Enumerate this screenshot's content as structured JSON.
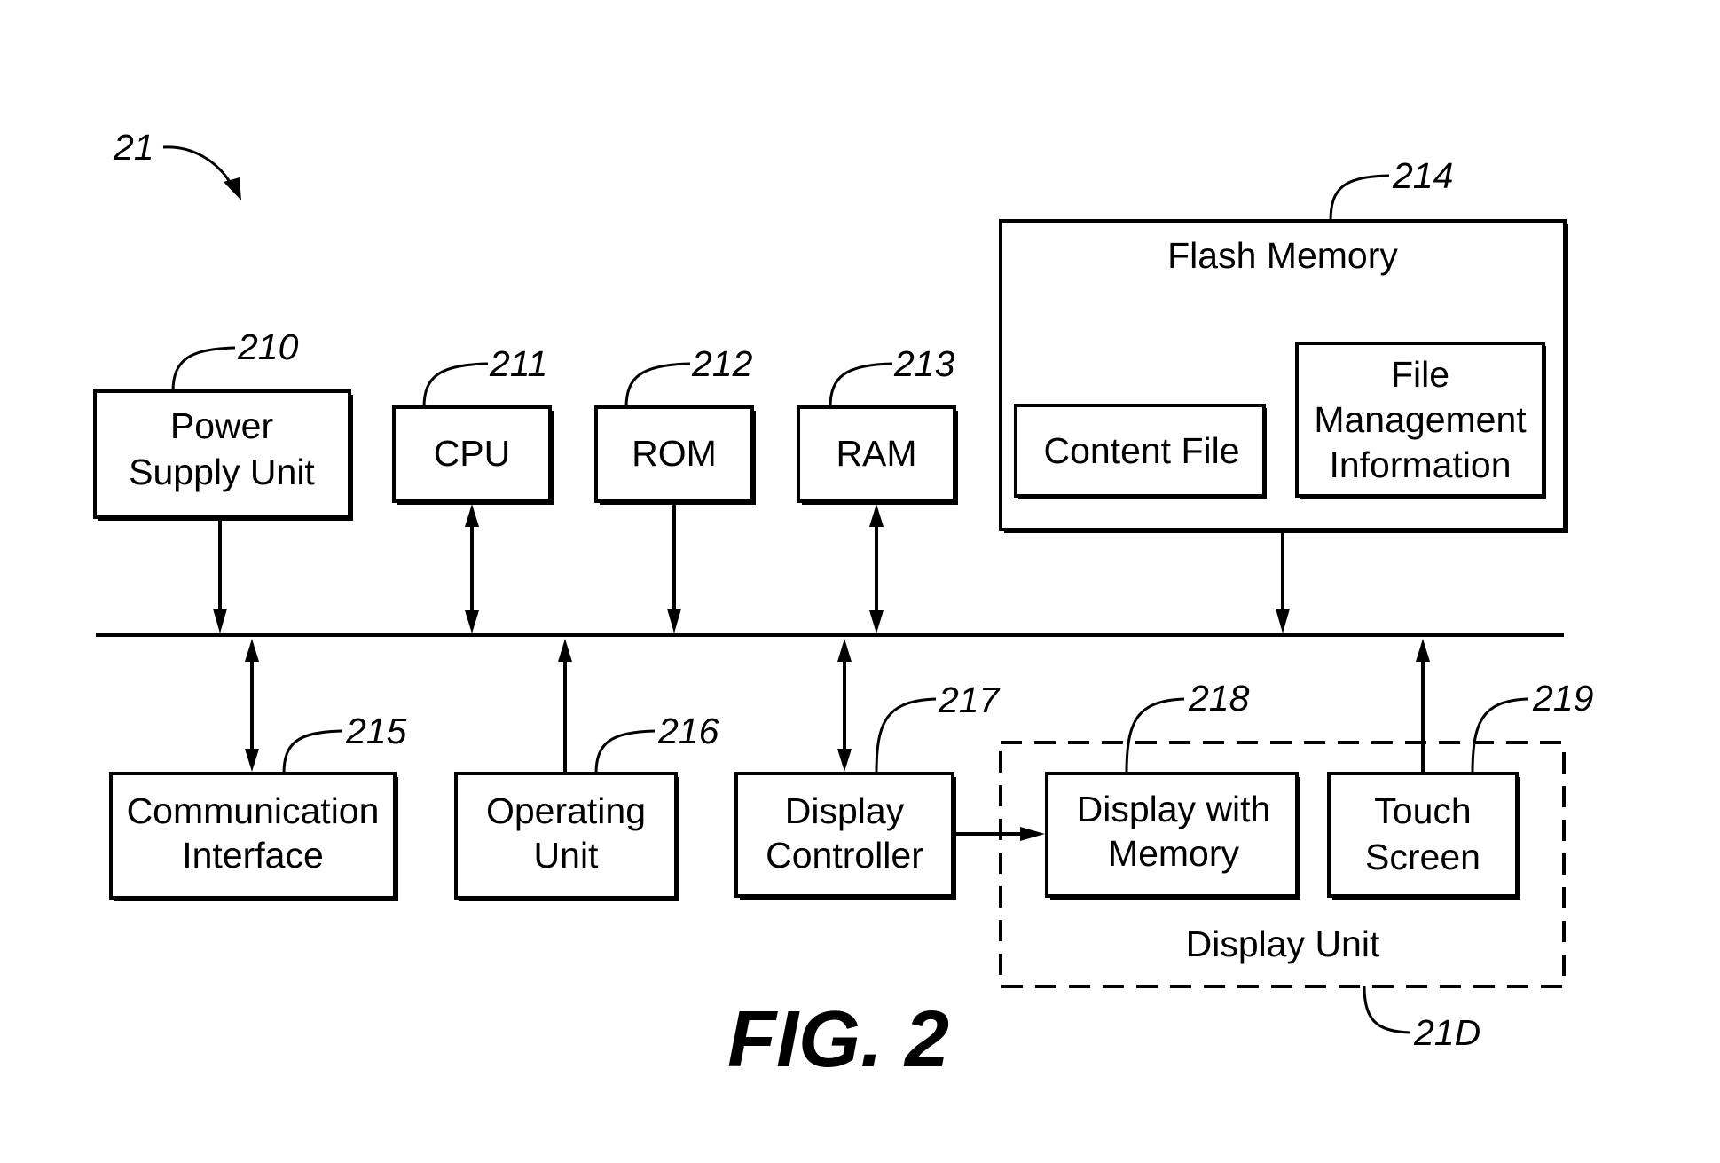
{
  "figure": {
    "label": "FIG. 2",
    "ref": "21"
  },
  "blocks": {
    "power": {
      "ref": "210",
      "lines": [
        "Power",
        "Supply Unit"
      ]
    },
    "cpu": {
      "ref": "211",
      "lines": [
        "CPU"
      ]
    },
    "rom": {
      "ref": "212",
      "lines": [
        "ROM"
      ]
    },
    "ram": {
      "ref": "213",
      "lines": [
        "RAM"
      ]
    },
    "flash": {
      "ref": "214",
      "title": "Flash Memory"
    },
    "content_file": {
      "lines": [
        "Content File"
      ]
    },
    "file_mgmt": {
      "lines": [
        "File",
        "Management",
        "Information"
      ]
    },
    "comm": {
      "ref": "215",
      "lines": [
        "Communication",
        "Interface"
      ]
    },
    "operating": {
      "ref": "216",
      "lines": [
        "Operating",
        "Unit"
      ]
    },
    "display_ctrl": {
      "ref": "217",
      "lines": [
        "Display",
        "Controller"
      ]
    },
    "display_mem": {
      "ref": "218",
      "lines": [
        "Display with",
        "Memory"
      ]
    },
    "touch": {
      "ref": "219",
      "lines": [
        "Touch",
        "Screen"
      ]
    },
    "display_unit": {
      "ref": "21D",
      "title": "Display Unit"
    }
  }
}
